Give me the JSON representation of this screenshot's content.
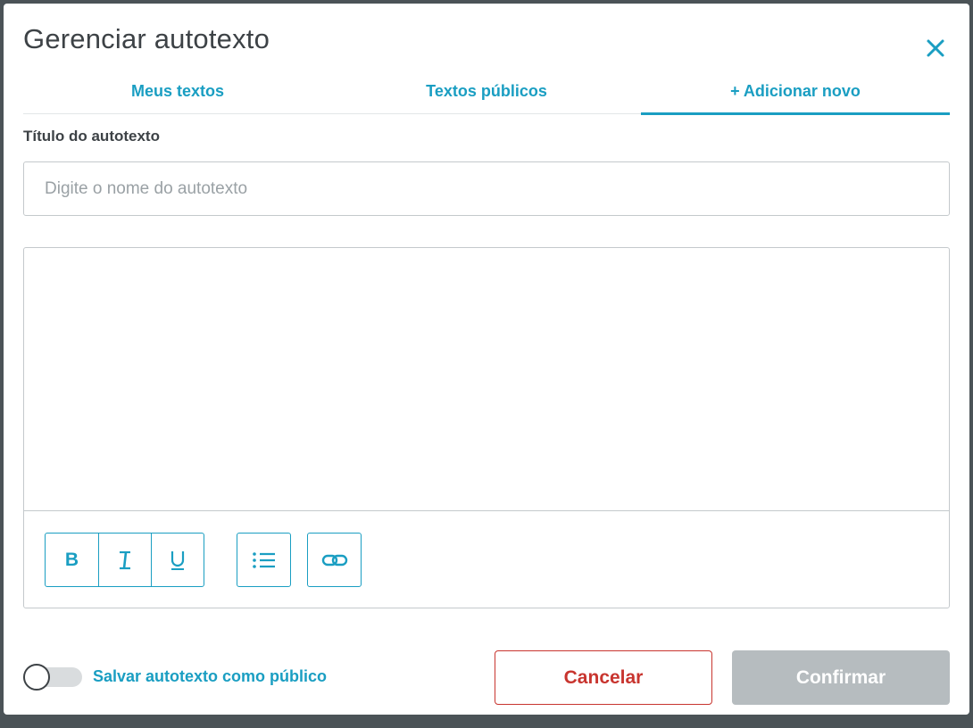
{
  "dialog": {
    "title": "Gerenciar autotexto",
    "close_icon": "close-icon"
  },
  "tabs": [
    {
      "label": "Meus textos",
      "active": false
    },
    {
      "label": "Textos públicos",
      "active": false
    },
    {
      "label": "+ Adicionar novo",
      "active": true
    }
  ],
  "form": {
    "title_label": "Título do autotexto",
    "title_placeholder": "Digite o nome do autotexto",
    "title_value": "",
    "body_value": ""
  },
  "toolbar": {
    "bold_label": "B",
    "italic_label": "I",
    "underline_label": "U",
    "list_icon": "bulleted-list-icon",
    "link_icon": "link-icon"
  },
  "footer": {
    "public_toggle_label": "Salvar autotexto como público",
    "public_toggle_on": false,
    "cancel_label": "Cancelar",
    "confirm_label": "Confirmar",
    "confirm_enabled": false
  },
  "colors": {
    "accent": "#1a9ec2",
    "danger": "#c8352f",
    "disabled": "#b6bcbf",
    "text": "#3d4246"
  }
}
